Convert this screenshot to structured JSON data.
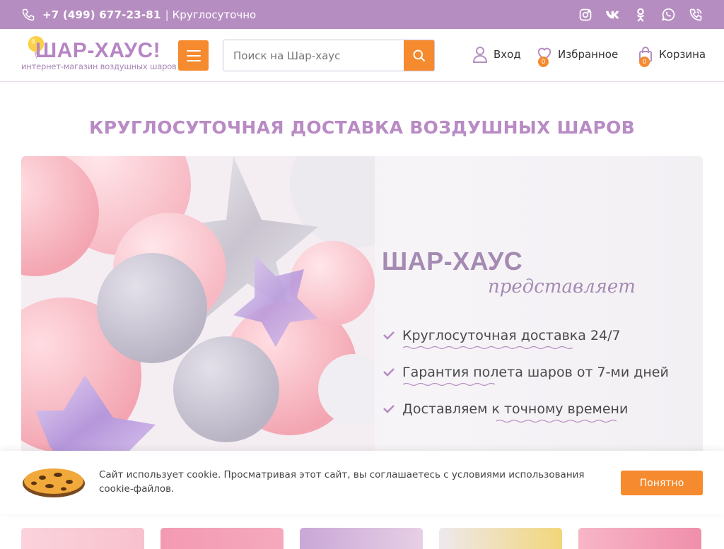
{
  "topbar": {
    "phone": "+7 (499) 677-23-81",
    "separator": "|",
    "hours": "Круглосуточно",
    "socials": [
      "instagram-icon",
      "vk-icon",
      "odnoklassniki-icon",
      "whatsapp-icon",
      "viber-icon"
    ]
  },
  "header": {
    "logo_title": "ШАР-ХАУС!",
    "logo_subtitle": "интернет-магазин воздушных шаров",
    "search_placeholder": "Поиск на Шар-хаус",
    "login_label": "Вход",
    "favorites_label": "Избранное",
    "favorites_count": "0",
    "cart_label": "Корзина",
    "cart_count": "0"
  },
  "headline": "КРУГЛОСУТОЧНАЯ ДОСТАВКА ВОЗДУШНЫХ ШАРОВ",
  "hero": {
    "title": "ШАР-ХАУС",
    "subtitle": "представляет",
    "items": [
      "Круглосуточная доставка 24/7",
      "Гарантия полета шаров от 7-ми дней",
      "Доставляем к точному времени"
    ]
  },
  "cookie": {
    "text": "Сайт использует cookie. Просматривая этот сайт, вы соглашаетесь с условиями использования cookie-файлов.",
    "button": "Понятно"
  },
  "colors": {
    "topbar": "#b68dc1",
    "accent": "#f58a2e",
    "headline": "#b98bc5"
  }
}
